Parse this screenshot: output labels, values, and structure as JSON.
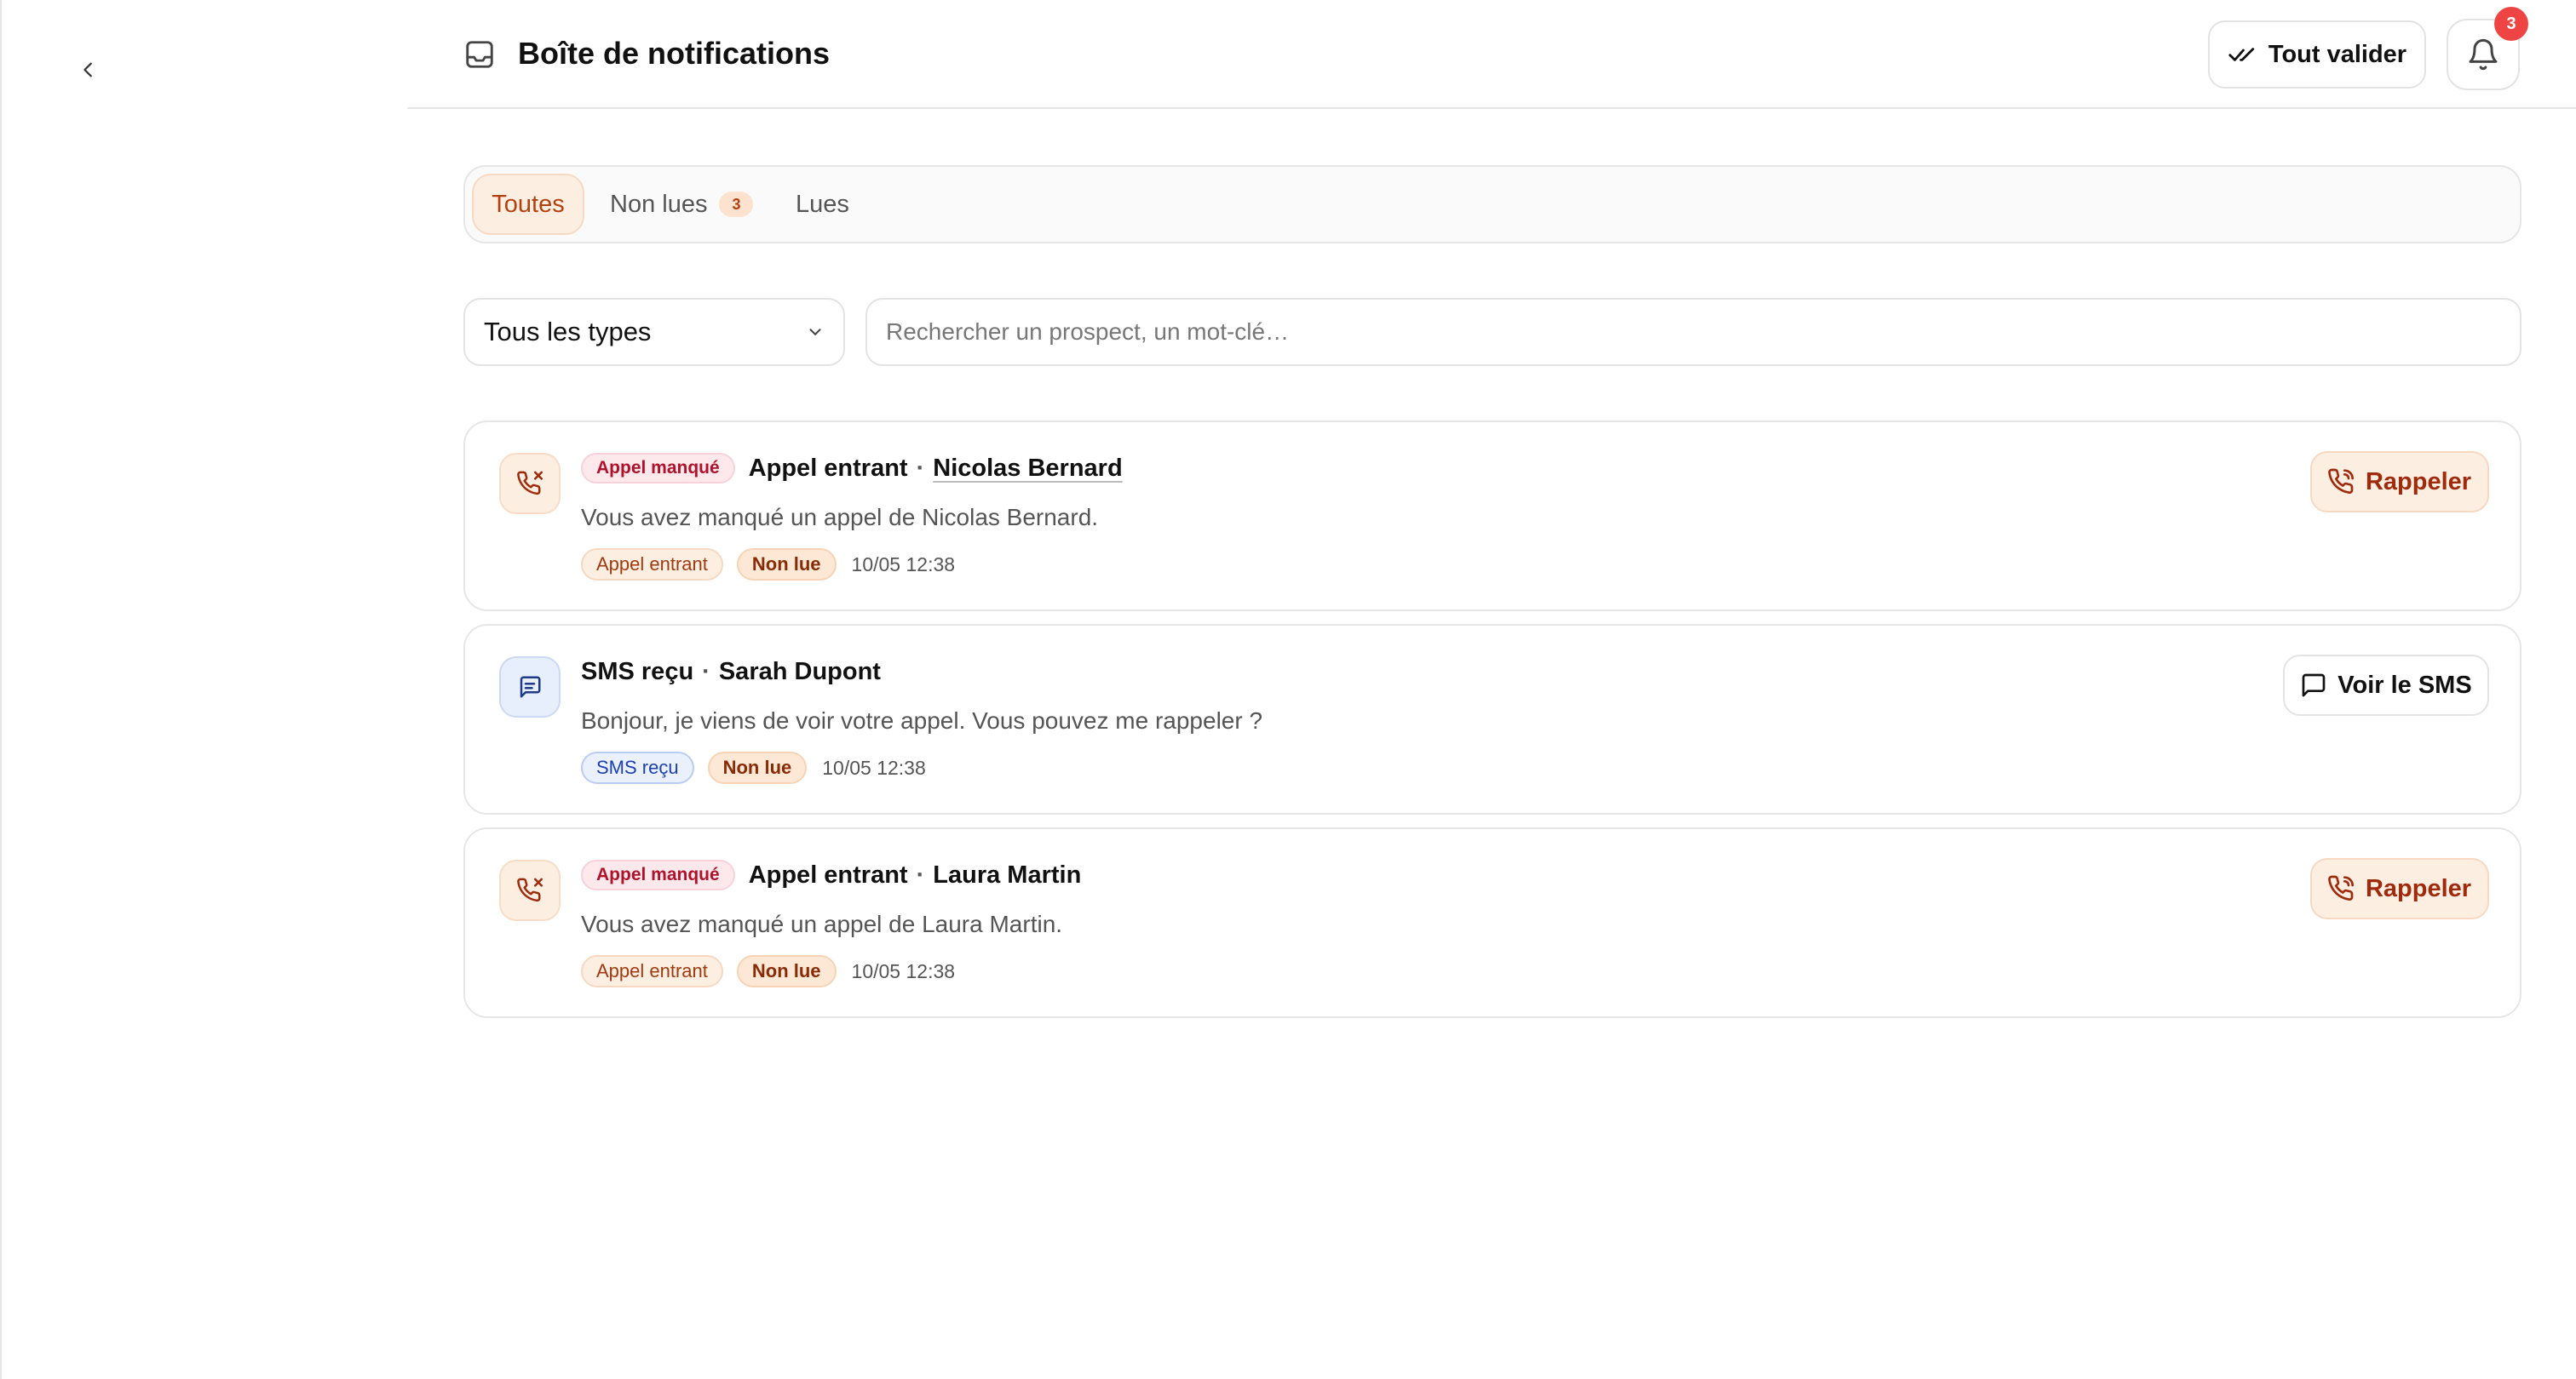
{
  "header": {
    "title": "Boîte de notifications",
    "validate_label": "Tout valider",
    "bell_badge": "3"
  },
  "tabs": [
    {
      "label": "Toutes",
      "active": true
    },
    {
      "label": "Non lues",
      "count": "3"
    },
    {
      "label": "Lues"
    }
  ],
  "filters": {
    "type_value": "Tous les types",
    "search_placeholder": "Rechercher un prospect, un mot-clé…",
    "search_value": ""
  },
  "notifications": [
    {
      "kind": "call",
      "tag": "Appel manqué",
      "title": "Appel entrant",
      "separator": "·",
      "person": "Nicolas Bernard",
      "description": "Vous avez manqué un appel de Nicolas Bernard.",
      "chips": [
        "Appel entrant",
        "Non lue"
      ],
      "time": "10/05 12:38",
      "action": "Rappeler"
    },
    {
      "kind": "sms",
      "tag": "",
      "title": "SMS reçu",
      "separator": "·",
      "person": "Sarah Dupont",
      "description": "Bonjour, je viens de voir votre appel. Vous pouvez me rappeler ?",
      "chips": [
        "SMS reçu",
        "Non lue"
      ],
      "time": "10/05 12:38",
      "action": "Voir le SMS"
    },
    {
      "kind": "call",
      "tag": "Appel manqué",
      "title": "Appel entrant",
      "separator": "·",
      "person": "Laura Martin",
      "description": "Vous avez manqué un appel de Laura Martin.",
      "chips": [
        "Appel entrant",
        "Non lue"
      ],
      "time": "10/05 12:38",
      "action": "Rappeler"
    }
  ],
  "icons": {
    "back": "chevron-left-icon",
    "inbox": "inbox-icon",
    "validate": "double-check-icon",
    "bell": "bell-icon",
    "select": "chevron-down-icon",
    "missed_call": "phone-missed-icon",
    "sms": "message-square-icon",
    "callback": "phone-callback-icon",
    "view_sms": "message-icon"
  },
  "colors": {
    "accent": "#a02a0c",
    "accent_bg": "#fdeee2",
    "missed_tag": "#b0122c",
    "sms_blue": "#1e40af",
    "badge_red": "#ef4444"
  }
}
